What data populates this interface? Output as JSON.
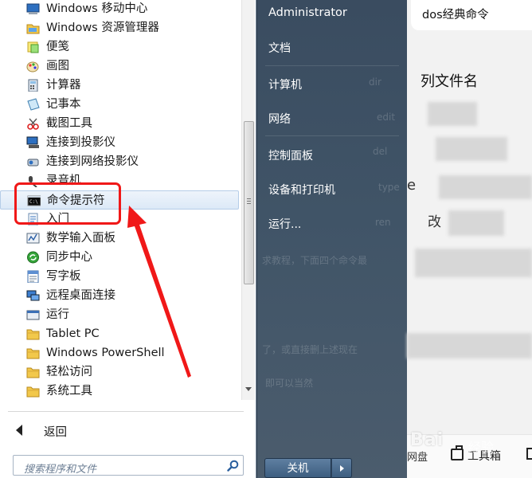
{
  "program_list": {
    "items": [
      {
        "label": "Windows 移动中心",
        "icon": "mobility-center-icon"
      },
      {
        "label": "Windows 资源管理器",
        "icon": "explorer-folder-icon"
      },
      {
        "label": "便笺",
        "icon": "sticky-notes-icon"
      },
      {
        "label": "画图",
        "icon": "paint-icon"
      },
      {
        "label": "计算器",
        "icon": "calculator-icon"
      },
      {
        "label": "记事本",
        "icon": "notepad-icon"
      },
      {
        "label": "截图工具",
        "icon": "snipping-tool-icon"
      },
      {
        "label": "连接到投影仪",
        "icon": "projector-icon"
      },
      {
        "label": "连接到网络投影仪",
        "icon": "network-projector-icon"
      },
      {
        "label": "录音机",
        "icon": "microphone-icon"
      },
      {
        "label": "命令提示符",
        "icon": "command-prompt-icon"
      },
      {
        "label": "入门",
        "icon": "getting-started-icon"
      },
      {
        "label": "数学输入面板",
        "icon": "math-input-icon"
      },
      {
        "label": "同步中心",
        "icon": "sync-center-icon"
      },
      {
        "label": "写字板",
        "icon": "wordpad-icon"
      },
      {
        "label": "远程桌面连接",
        "icon": "remote-desktop-icon"
      },
      {
        "label": "运行",
        "icon": "run-icon"
      },
      {
        "label": "Tablet PC",
        "icon": "folder-icon"
      },
      {
        "label": "Windows PowerShell",
        "icon": "folder-icon"
      },
      {
        "label": "轻松访问",
        "icon": "folder-icon"
      },
      {
        "label": "系统工具",
        "icon": "folder-icon"
      }
    ],
    "selected_label": "命令提示符",
    "back_label": "返回"
  },
  "search": {
    "placeholder": "搜索程序和文件"
  },
  "right_menu": {
    "user": "Administrator",
    "items": [
      "文档",
      "计算机",
      "网络",
      "控制面板",
      "设备和打印机",
      "运行..."
    ],
    "shutdown_label": "关机"
  },
  "background_page": {
    "search_text": "dos经典命令",
    "heading": "列文件名",
    "partial_e": "e",
    "partial_gai": "改",
    "footer_left": "网盘",
    "footer_tools": "工具箱",
    "watermark": "Bai",
    "watermark_suffix": "经验"
  },
  "colors": {
    "highlight_red": "#f01818",
    "start_menu_dark": "#3a4c60",
    "selection_blue": "#dce9f7"
  }
}
